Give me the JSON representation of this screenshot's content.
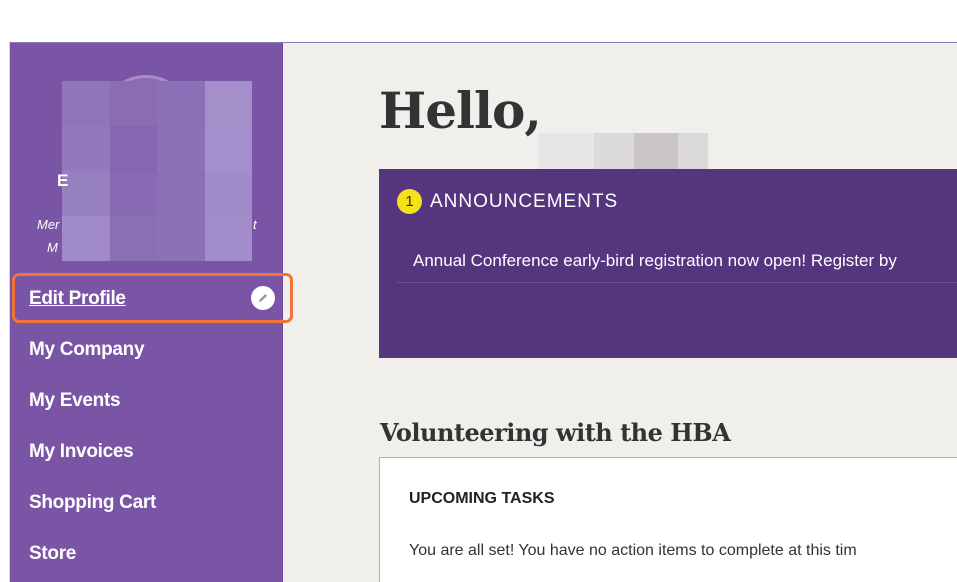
{
  "sidebar": {
    "name_initial": "E",
    "member_prefix": "Mer",
    "member_suffix": "t",
    "member2_prefix": "M",
    "nav": [
      {
        "label": "Edit Profile"
      },
      {
        "label": "My Company"
      },
      {
        "label": "My Events"
      },
      {
        "label": "My Invoices"
      },
      {
        "label": "Shopping Cart"
      },
      {
        "label": "Store"
      }
    ],
    "edit_icon": "pencil-icon"
  },
  "main": {
    "greeting": "Hello,",
    "announcements": {
      "count": "1",
      "title": "ANNOUNCEMENTS",
      "items": [
        "Annual Conference early-bird registration now open! Register by"
      ]
    },
    "volunteering": {
      "title": "Volunteering with the HBA",
      "tasks_title": "UPCOMING TASKS",
      "tasks_text": "You are all set! You have no action items to complete at this tim"
    }
  },
  "colors": {
    "sidebar_bg": "#7a55a6",
    "announce_bg": "#56357f",
    "badge": "#f5e11a",
    "highlight": "#f0743a",
    "page_bg": "#f1efeb"
  }
}
